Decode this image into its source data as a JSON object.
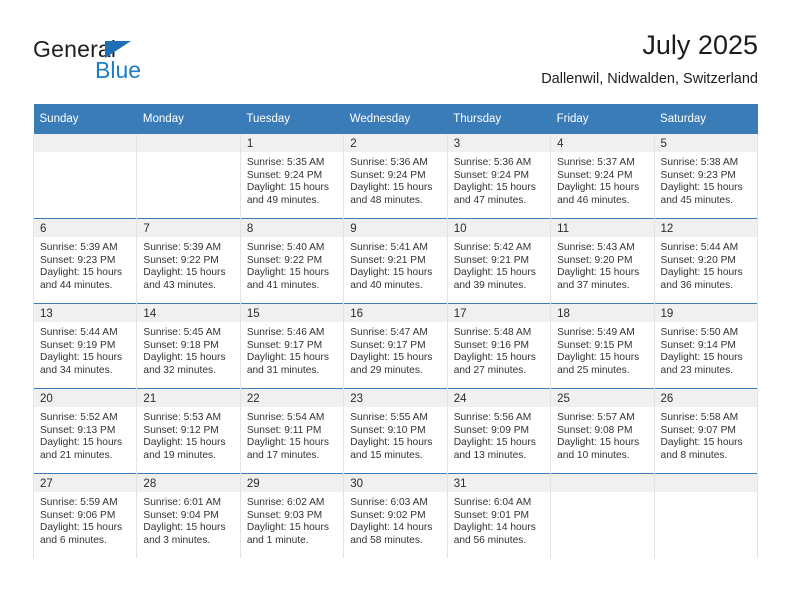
{
  "logo": {
    "word_one": "General",
    "word_two": "Blue",
    "triangle_icon": "triangle-icon",
    "brand_blue": "#1f7dc4"
  },
  "header": {
    "title": "July 2025",
    "location": "Dallenwil, Nidwalden, Switzerland"
  },
  "calendar": {
    "header_bg": "#3a7cb8",
    "row_accent": "#3a7cb8",
    "daynum_bg": "#f0f0f0",
    "weekdays": [
      "Sunday",
      "Monday",
      "Tuesday",
      "Wednesday",
      "Thursday",
      "Friday",
      "Saturday"
    ],
    "weeks": [
      [
        {
          "day": ""
        },
        {
          "day": ""
        },
        {
          "day": "1",
          "sunrise": "Sunrise: 5:35 AM",
          "sunset": "Sunset: 9:24 PM",
          "daylight": "Daylight: 15 hours and 49 minutes."
        },
        {
          "day": "2",
          "sunrise": "Sunrise: 5:36 AM",
          "sunset": "Sunset: 9:24 PM",
          "daylight": "Daylight: 15 hours and 48 minutes."
        },
        {
          "day": "3",
          "sunrise": "Sunrise: 5:36 AM",
          "sunset": "Sunset: 9:24 PM",
          "daylight": "Daylight: 15 hours and 47 minutes."
        },
        {
          "day": "4",
          "sunrise": "Sunrise: 5:37 AM",
          "sunset": "Sunset: 9:24 PM",
          "daylight": "Daylight: 15 hours and 46 minutes."
        },
        {
          "day": "5",
          "sunrise": "Sunrise: 5:38 AM",
          "sunset": "Sunset: 9:23 PM",
          "daylight": "Daylight: 15 hours and 45 minutes."
        }
      ],
      [
        {
          "day": "6",
          "sunrise": "Sunrise: 5:39 AM",
          "sunset": "Sunset: 9:23 PM",
          "daylight": "Daylight: 15 hours and 44 minutes."
        },
        {
          "day": "7",
          "sunrise": "Sunrise: 5:39 AM",
          "sunset": "Sunset: 9:22 PM",
          "daylight": "Daylight: 15 hours and 43 minutes."
        },
        {
          "day": "8",
          "sunrise": "Sunrise: 5:40 AM",
          "sunset": "Sunset: 9:22 PM",
          "daylight": "Daylight: 15 hours and 41 minutes."
        },
        {
          "day": "9",
          "sunrise": "Sunrise: 5:41 AM",
          "sunset": "Sunset: 9:21 PM",
          "daylight": "Daylight: 15 hours and 40 minutes."
        },
        {
          "day": "10",
          "sunrise": "Sunrise: 5:42 AM",
          "sunset": "Sunset: 9:21 PM",
          "daylight": "Daylight: 15 hours and 39 minutes."
        },
        {
          "day": "11",
          "sunrise": "Sunrise: 5:43 AM",
          "sunset": "Sunset: 9:20 PM",
          "daylight": "Daylight: 15 hours and 37 minutes."
        },
        {
          "day": "12",
          "sunrise": "Sunrise: 5:44 AM",
          "sunset": "Sunset: 9:20 PM",
          "daylight": "Daylight: 15 hours and 36 minutes."
        }
      ],
      [
        {
          "day": "13",
          "sunrise": "Sunrise: 5:44 AM",
          "sunset": "Sunset: 9:19 PM",
          "daylight": "Daylight: 15 hours and 34 minutes."
        },
        {
          "day": "14",
          "sunrise": "Sunrise: 5:45 AM",
          "sunset": "Sunset: 9:18 PM",
          "daylight": "Daylight: 15 hours and 32 minutes."
        },
        {
          "day": "15",
          "sunrise": "Sunrise: 5:46 AM",
          "sunset": "Sunset: 9:17 PM",
          "daylight": "Daylight: 15 hours and 31 minutes."
        },
        {
          "day": "16",
          "sunrise": "Sunrise: 5:47 AM",
          "sunset": "Sunset: 9:17 PM",
          "daylight": "Daylight: 15 hours and 29 minutes."
        },
        {
          "day": "17",
          "sunrise": "Sunrise: 5:48 AM",
          "sunset": "Sunset: 9:16 PM",
          "daylight": "Daylight: 15 hours and 27 minutes."
        },
        {
          "day": "18",
          "sunrise": "Sunrise: 5:49 AM",
          "sunset": "Sunset: 9:15 PM",
          "daylight": "Daylight: 15 hours and 25 minutes."
        },
        {
          "day": "19",
          "sunrise": "Sunrise: 5:50 AM",
          "sunset": "Sunset: 9:14 PM",
          "daylight": "Daylight: 15 hours and 23 minutes."
        }
      ],
      [
        {
          "day": "20",
          "sunrise": "Sunrise: 5:52 AM",
          "sunset": "Sunset: 9:13 PM",
          "daylight": "Daylight: 15 hours and 21 minutes."
        },
        {
          "day": "21",
          "sunrise": "Sunrise: 5:53 AM",
          "sunset": "Sunset: 9:12 PM",
          "daylight": "Daylight: 15 hours and 19 minutes."
        },
        {
          "day": "22",
          "sunrise": "Sunrise: 5:54 AM",
          "sunset": "Sunset: 9:11 PM",
          "daylight": "Daylight: 15 hours and 17 minutes."
        },
        {
          "day": "23",
          "sunrise": "Sunrise: 5:55 AM",
          "sunset": "Sunset: 9:10 PM",
          "daylight": "Daylight: 15 hours and 15 minutes."
        },
        {
          "day": "24",
          "sunrise": "Sunrise: 5:56 AM",
          "sunset": "Sunset: 9:09 PM",
          "daylight": "Daylight: 15 hours and 13 minutes."
        },
        {
          "day": "25",
          "sunrise": "Sunrise: 5:57 AM",
          "sunset": "Sunset: 9:08 PM",
          "daylight": "Daylight: 15 hours and 10 minutes."
        },
        {
          "day": "26",
          "sunrise": "Sunrise: 5:58 AM",
          "sunset": "Sunset: 9:07 PM",
          "daylight": "Daylight: 15 hours and 8 minutes."
        }
      ],
      [
        {
          "day": "27",
          "sunrise": "Sunrise: 5:59 AM",
          "sunset": "Sunset: 9:06 PM",
          "daylight": "Daylight: 15 hours and 6 minutes."
        },
        {
          "day": "28",
          "sunrise": "Sunrise: 6:01 AM",
          "sunset": "Sunset: 9:04 PM",
          "daylight": "Daylight: 15 hours and 3 minutes."
        },
        {
          "day": "29",
          "sunrise": "Sunrise: 6:02 AM",
          "sunset": "Sunset: 9:03 PM",
          "daylight": "Daylight: 15 hours and 1 minute."
        },
        {
          "day": "30",
          "sunrise": "Sunrise: 6:03 AM",
          "sunset": "Sunset: 9:02 PM",
          "daylight": "Daylight: 14 hours and 58 minutes."
        },
        {
          "day": "31",
          "sunrise": "Sunrise: 6:04 AM",
          "sunset": "Sunset: 9:01 PM",
          "daylight": "Daylight: 14 hours and 56 minutes."
        },
        {
          "day": ""
        },
        {
          "day": ""
        }
      ]
    ]
  }
}
